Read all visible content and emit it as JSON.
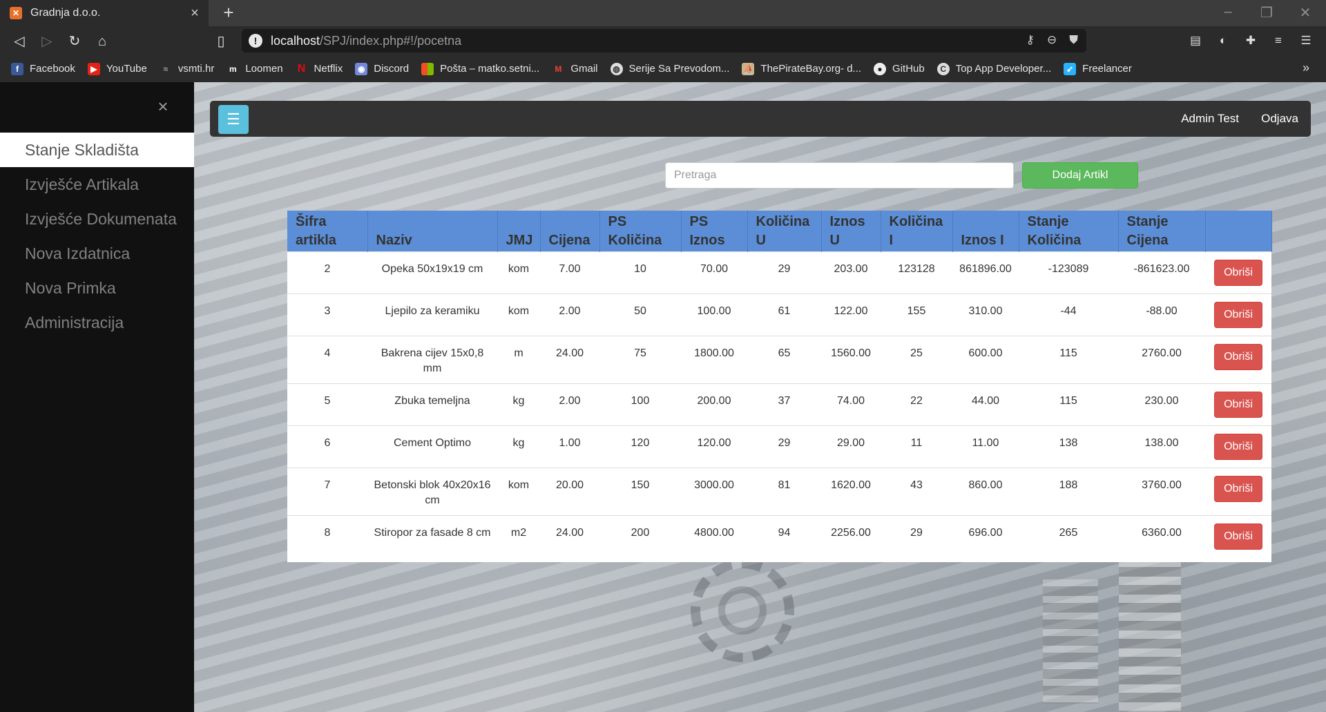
{
  "browser": {
    "tab_title": "Gradnja d.o.o.",
    "url_host": "localhost",
    "url_path": "/SPJ/index.php#!/pocetna",
    "bookmarks": [
      "Facebook",
      "YouTube",
      "vsmti.hr",
      "Loomen",
      "Netflix",
      "Discord",
      "Pošta – matko.setni...",
      "Gmail",
      "Serije Sa Prevodom...",
      "ThePirateBay.org- d...",
      "GitHub",
      "Top App Developer...",
      "Freelancer"
    ]
  },
  "sidebar": {
    "items": [
      {
        "label": "Stanje Skladišta",
        "active": true
      },
      {
        "label": "Izvješće Artikala"
      },
      {
        "label": "Izvješće Dokumenata"
      },
      {
        "label": "Nova Izdatnica"
      },
      {
        "label": "Nova Primka"
      },
      {
        "label": "Administracija"
      }
    ]
  },
  "navbar": {
    "user": "Admin Test",
    "logout": "Odjava"
  },
  "search": {
    "placeholder": "Pretraga",
    "add_label": "Dodaj Artikl"
  },
  "table": {
    "headers": [
      "Šifra artikla",
      "Naziv",
      "JMJ",
      "Cijena",
      "PS Količina",
      "PS Iznos",
      "Količina U",
      "Iznos U",
      "Količina I",
      "Iznos I",
      "Stanje Količina",
      "Stanje Cijena",
      ""
    ],
    "delete_label": "Obriši",
    "rows": [
      [
        "2",
        "Opeka 50x19x19 cm",
        "kom",
        "7.00",
        "10",
        "70.00",
        "29",
        "203.00",
        "123128",
        "861896.00",
        "-123089",
        "-861623.00"
      ],
      [
        "3",
        "Ljepilo za keramiku",
        "kom",
        "2.00",
        "50",
        "100.00",
        "61",
        "122.00",
        "155",
        "310.00",
        "-44",
        "-88.00"
      ],
      [
        "4",
        "Bakrena cijev 15x0,8 mm",
        "m",
        "24.00",
        "75",
        "1800.00",
        "65",
        "1560.00",
        "25",
        "600.00",
        "115",
        "2760.00"
      ],
      [
        "5",
        "Zbuka temeljna",
        "kg",
        "2.00",
        "100",
        "200.00",
        "37",
        "74.00",
        "22",
        "44.00",
        "115",
        "230.00"
      ],
      [
        "6",
        "Cement Optimo",
        "kg",
        "1.00",
        "120",
        "120.00",
        "29",
        "29.00",
        "11",
        "11.00",
        "138",
        "138.00"
      ],
      [
        "7",
        "Betonski blok 40x20x16 cm",
        "kom",
        "20.00",
        "150",
        "3000.00",
        "81",
        "1620.00",
        "43",
        "860.00",
        "188",
        "3760.00"
      ],
      [
        "8",
        "Stiropor za fasade 8 cm",
        "m2",
        "24.00",
        "200",
        "4800.00",
        "94",
        "2256.00",
        "29",
        "696.00",
        "265",
        "6360.00"
      ]
    ]
  }
}
